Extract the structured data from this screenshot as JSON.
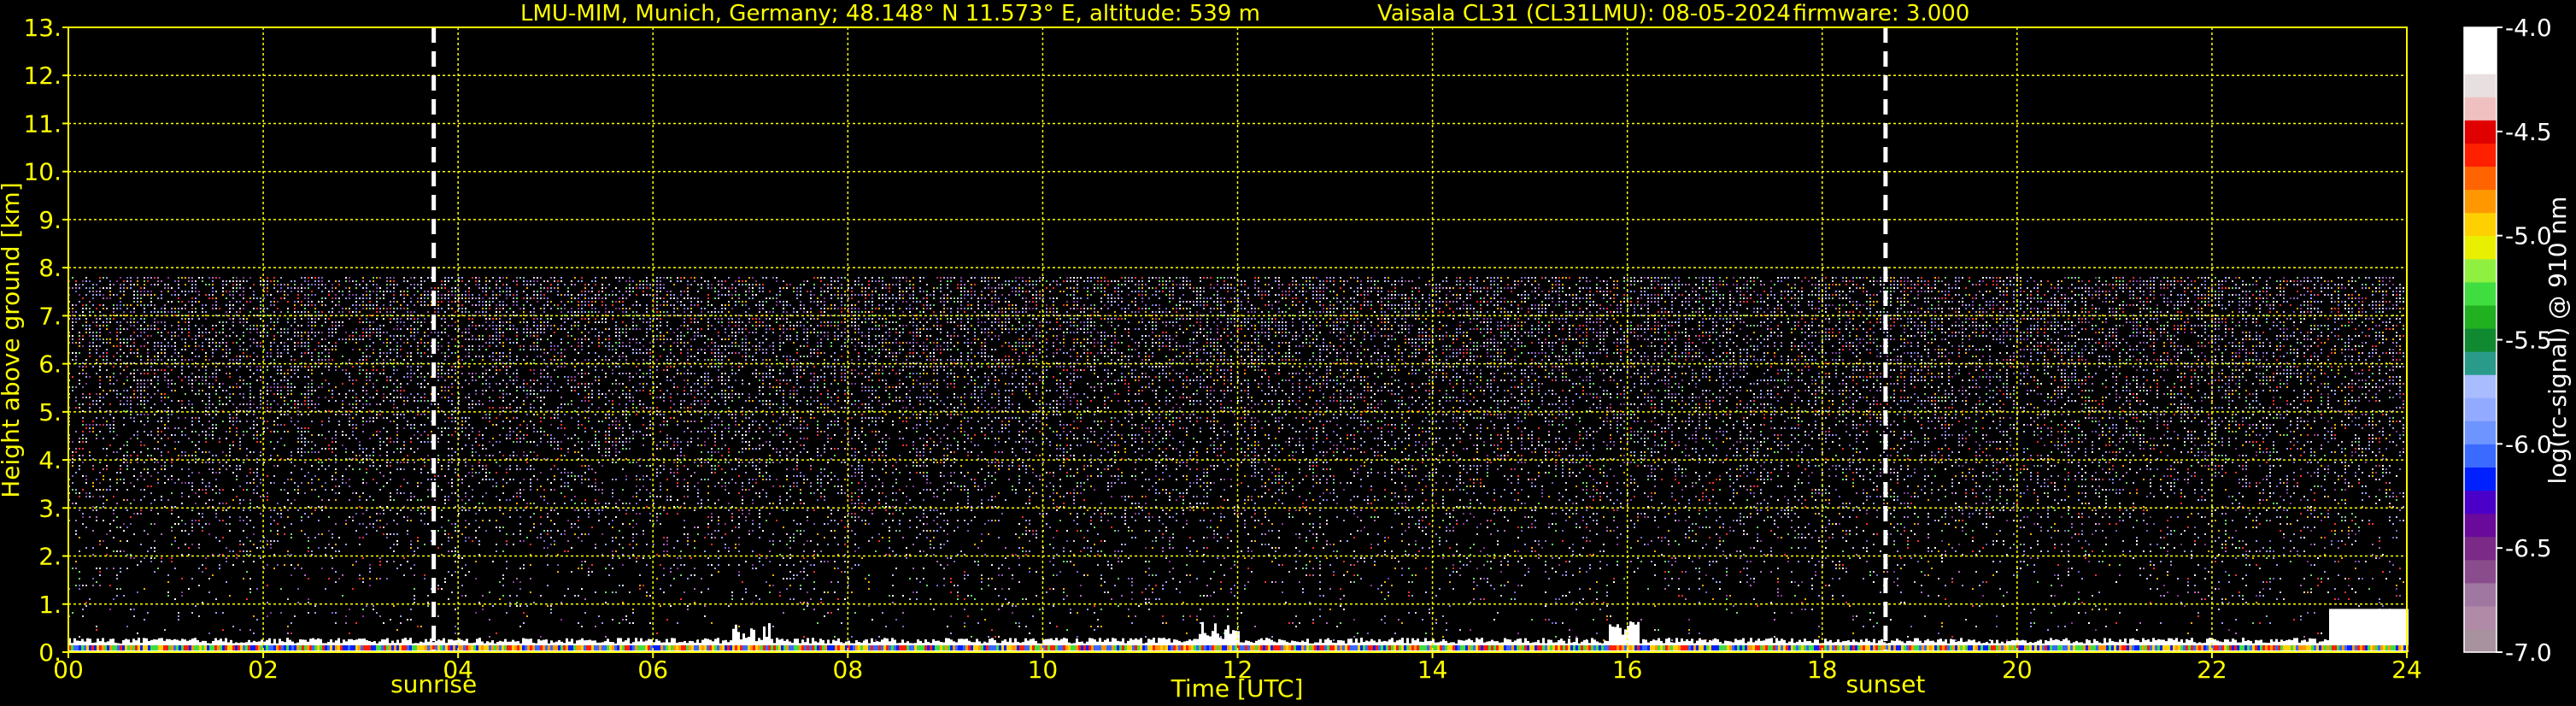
{
  "header": {
    "station": "LMU-MIM, Munich, Germany; 48.148° N 11.573° E, altitude: 539 m",
    "instrument": "Vaisala CL31 (CL31LMU): 08-05-2024",
    "firmware": "firmware: 3.000"
  },
  "colors": {
    "background": "#000000",
    "text": "#ffff00",
    "grid": "#ffff00",
    "marker": "#ffffff"
  },
  "chart_data": {
    "type": "heatmap",
    "xlabel": "Time [UTC]",
    "ylabel": "Height above ground [km]",
    "xlim": [
      0,
      24
    ],
    "ylim": [
      0,
      13
    ],
    "x_ticks": [
      0,
      2,
      4,
      6,
      8,
      10,
      12,
      14,
      16,
      18,
      20,
      22,
      24
    ],
    "x_tick_labels": [
      "00",
      "02",
      "04",
      "06",
      "08",
      "10",
      "12",
      "14",
      "16",
      "18",
      "20",
      "22",
      "24"
    ],
    "y_ticks": [
      0,
      1,
      2,
      3,
      4,
      5,
      6,
      7,
      8,
      9,
      10,
      11,
      12,
      13
    ],
    "y_tick_labels": [
      "0.",
      "1.",
      "2.",
      "3.",
      "4.",
      "5.",
      "6.",
      "7.",
      "8.",
      "9.",
      "10.",
      "11.",
      "12.",
      "13."
    ],
    "grid": true,
    "markers": [
      {
        "name": "sunrise",
        "time_utc": 3.75
      },
      {
        "name": "sunset",
        "time_utc": 18.65
      }
    ],
    "signal_top_km": 7.8,
    "colorbar": {
      "label": "log(rc-signal) @ 910 nm",
      "range": [
        -7.0,
        -4.0
      ],
      "ticks": [
        -7.0,
        -6.5,
        -6.0,
        -5.5,
        -5.0,
        -4.5,
        -4.0
      ],
      "tick_labels": [
        "-7.0",
        "-6.5",
        "-6.0",
        "-5.5",
        "-5.0",
        "-4.5",
        "-4.0"
      ],
      "colors": [
        "#a8929f",
        "#b08aa7",
        "#a077a0",
        "#8a4c8c",
        "#7b2a87",
        "#6a0a9a",
        "#4a00c8",
        "#0020ff",
        "#3a6aff",
        "#6e94ff",
        "#92aaff",
        "#a8bcff",
        "#2a9a8a",
        "#108a30",
        "#20b020",
        "#40dd40",
        "#90f040",
        "#e8f000",
        "#ffd000",
        "#ff9800",
        "#ff6400",
        "#ff2000",
        "#e00000",
        "#f0c0c0",
        "#e8e0e0",
        "#ffffff",
        "#ffffff"
      ]
    }
  }
}
